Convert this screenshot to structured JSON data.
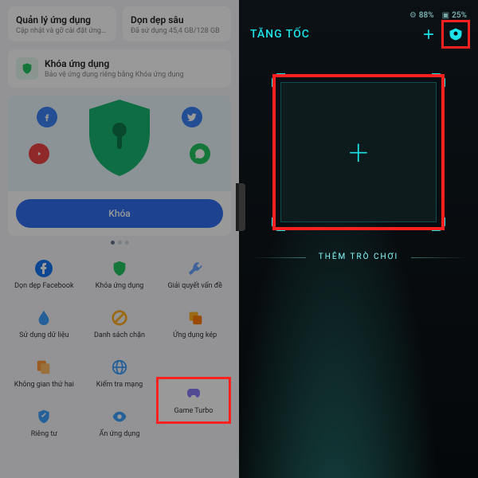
{
  "left": {
    "cards": [
      {
        "title": "Quản lý ứng dụng",
        "sub": "Cập nhật và gỡ cài đặt ứng…"
      },
      {
        "title": "Dọn dẹp sâu",
        "sub": "Đã sử dụng 45,4 GB/128 GB"
      }
    ],
    "lock": {
      "title": "Khóa ứng dụng",
      "sub": "Bảo vệ ứng dụng riêng bằng Khóa ứng dụng"
    },
    "promo_cta": "Khóa",
    "tools": [
      {
        "id": "facebook-clean",
        "label": "Dọn dẹp Facebook"
      },
      {
        "id": "app-lock",
        "label": "Khóa ứng dụng"
      },
      {
        "id": "troubleshoot",
        "label": "Giải quyết vấn đề"
      },
      {
        "id": "data-usage",
        "label": "Sử dụng dữ liệu"
      },
      {
        "id": "blocklist",
        "label": "Danh sách chặn"
      },
      {
        "id": "dual-apps",
        "label": "Ứng dụng kép"
      },
      {
        "id": "second-space",
        "label": "Không gian thứ hai"
      },
      {
        "id": "network-test",
        "label": "Kiểm tra mạng"
      },
      {
        "id": "game-turbo",
        "label": "Game Turbo"
      },
      {
        "id": "privacy",
        "label": "Riêng tư"
      },
      {
        "id": "hide-apps",
        "label": "Ẩn ứng dụng"
      }
    ]
  },
  "right": {
    "title": "TĂNG TỐC",
    "pct1": "88%",
    "pct2": "25%",
    "add_section": "THÊM TRÒ CHƠI"
  },
  "colors": {
    "highlight": "#ff2020",
    "teal": "#1de2e8"
  }
}
